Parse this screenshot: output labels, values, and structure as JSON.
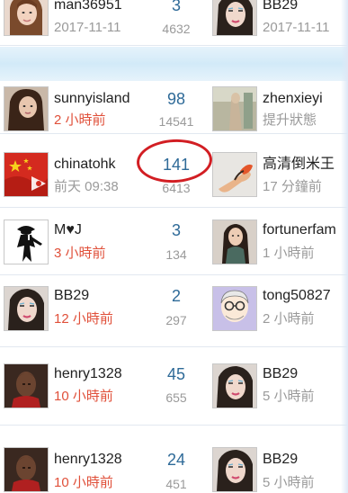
{
  "rows": [
    {
      "left": {
        "user": "man36951",
        "time": "2017-11-11",
        "time_color": "gray",
        "avatar": "woman-selfie-avatar"
      },
      "replies": "3",
      "views": "4632",
      "right": {
        "user": "BB29",
        "time": "2017-11-11",
        "time_color": "gray",
        "avatar": "woman-portrait-avatar"
      }
    },
    {
      "left": {
        "user": "sunnyisland",
        "time": "2 小時前",
        "time_color": "red",
        "avatar": "woman-long-hair-avatar"
      },
      "replies": "98",
      "views": "14541",
      "right": {
        "user": "zhenxieyi",
        "time": "提升狀態",
        "time_color": "gray",
        "avatar": "figure-photo-avatar"
      }
    },
    {
      "left": {
        "user": "chinatohk",
        "time": "前天 09:38",
        "time_color": "gray",
        "avatar": "red-flag-avatar"
      },
      "replies": "141",
      "views": "6413",
      "right": {
        "user": "高清倒米王",
        "time": "17 分鐘前",
        "time_color": "gray",
        "avatar": "hand-object-avatar"
      }
    },
    {
      "left": {
        "user": "M♥J",
        "time": "3 小時前",
        "time_color": "red",
        "avatar": "dancer-silhouette-avatar"
      },
      "replies": "3",
      "views": "134",
      "right": {
        "user": "fortunerfam",
        "time": "1 小時前",
        "time_color": "gray",
        "avatar": "woman-pose-avatar"
      }
    },
    {
      "left": {
        "user": "BB29",
        "time": "12 小時前",
        "time_color": "red",
        "avatar": "woman-portrait-avatar"
      },
      "replies": "2",
      "views": "297",
      "right": {
        "user": "tong50827",
        "time": "2 小時前",
        "time_color": "gray",
        "avatar": "cartoon-old-man-avatar"
      }
    },
    {
      "left": {
        "user": "henry1328",
        "time": "10 小時前",
        "time_color": "red",
        "avatar": "man-portrait-avatar"
      },
      "replies": "45",
      "views": "655",
      "right": {
        "user": "BB29",
        "time": "5 小時前",
        "time_color": "gray",
        "avatar": "woman-portrait-avatar"
      }
    },
    {
      "left": {
        "user": "henry1328",
        "time": "10 小時前",
        "time_color": "red",
        "avatar": "man-portrait-avatar"
      },
      "replies": "24",
      "views": "451",
      "right": {
        "user": "BB29",
        "time": "5 小時前",
        "time_color": "gray",
        "avatar": "woman-portrait-avatar"
      }
    }
  ],
  "highlight": {
    "target": "replies of chinatohk row",
    "color": "#d21e23"
  },
  "colors": {
    "link": "#2e6a98",
    "recent": "#e0503a",
    "muted": "#9a9a9a",
    "band": "#d2eaf8"
  }
}
